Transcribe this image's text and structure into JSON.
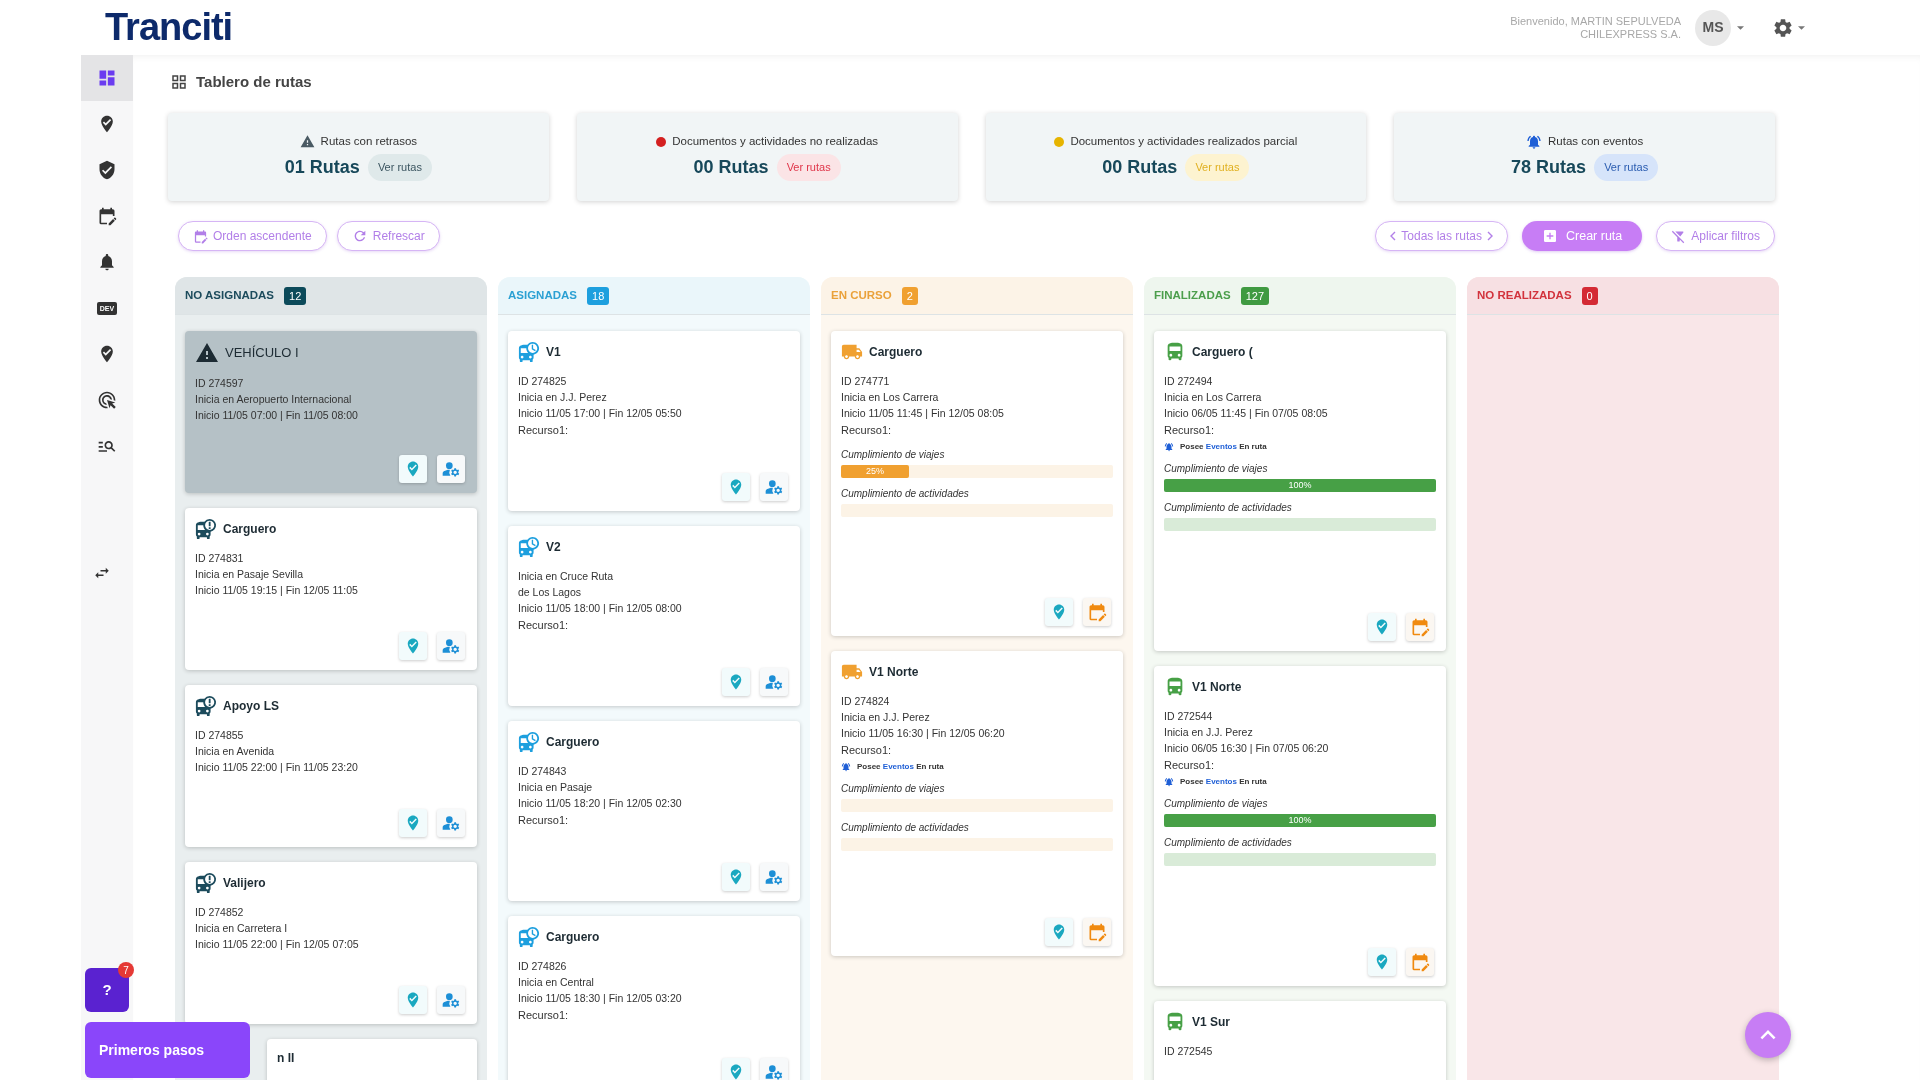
{
  "header": {
    "logo": "Tranciti",
    "welcome": "Bienvenido, MARTIN SEPULVEDA",
    "company": "CHILEXPRESS S.A.",
    "avatar": "MS"
  },
  "sidebar": {
    "items": [
      {
        "kind": "dashboard",
        "selected": true
      },
      {
        "kind": "pin-check",
        "selected": false
      },
      {
        "kind": "shield",
        "selected": false
      },
      {
        "kind": "calendar",
        "selected": false
      },
      {
        "kind": "bell",
        "selected": false
      },
      {
        "kind": "dev",
        "label": "DEV",
        "selected": false
      },
      {
        "kind": "pin-check",
        "selected": false
      },
      {
        "kind": "click",
        "selected": false
      },
      {
        "kind": "list-search",
        "selected": false
      }
    ]
  },
  "page_title": "Tablero de rutas",
  "summary_cards": [
    {
      "kind": "delay",
      "label": "Rutas con retrasos",
      "count": "01 Rutas",
      "button": "Ver rutas"
    },
    {
      "kind": "not_done",
      "label": "Documentos y actividades no realizadas",
      "count": "00 Rutas",
      "button": "Ver rutas"
    },
    {
      "kind": "partial",
      "label": "Documentos y actividades realizados parcial",
      "count": "00 Rutas",
      "button": "Ver rutas"
    },
    {
      "kind": "events",
      "label": "Rutas con eventos",
      "count": "78 Rutas",
      "button": "Ver rutas"
    }
  ],
  "toolbar": {
    "left": [
      {
        "kind": "sort",
        "label": "Orden ascendente"
      },
      {
        "kind": "refresh",
        "label": "Refrescar"
      }
    ],
    "right": [
      {
        "kind": "pager",
        "label": "Todas las rutas"
      },
      {
        "kind": "create",
        "label": "Crear ruta"
      },
      {
        "kind": "filter",
        "label": "Aplicar filtros"
      }
    ]
  },
  "columns": [
    {
      "kind": "unassigned",
      "title": "NO ASIGNADAS",
      "count": "12",
      "cards": [
        {
          "title": "VEHÍCULO I",
          "kind": "alert",
          "highlighted": true,
          "lines": [
            "ID 274597",
            "Inicia en Aeropuerto Internacional",
            "Inicio 11/05 07:00 | Fin 11/05 08:00"
          ]
        },
        {
          "title": "Carguero",
          "kind": "bus-alert",
          "highlighted": false,
          "lines": [
            "ID 274831",
            "Inicia en Pasaje Sevilla",
            "Inicio 11/05 19:15 | Fin 12/05 11:05"
          ]
        },
        {
          "title": "Apoyo LS",
          "kind": "bus-alert",
          "highlighted": false,
          "lines": [
            "ID 274855",
            "Inicia en Avenida",
            "Inicio 11/05 22:00 | Fin 11/05 23:20"
          ]
        },
        {
          "title": "Valijero",
          "kind": "bus-alert",
          "highlighted": false,
          "lines": [
            "ID 274852",
            "Inicia en Carretera I",
            "Inicio 11/05 22:00 | Fin 12/05 07:05"
          ]
        },
        {
          "title": "n II",
          "kind": "covered",
          "highlighted": false
        }
      ]
    },
    {
      "kind": "assigned",
      "title": "ASIGNADAS",
      "count": "18",
      "cards": [
        {
          "title": "V1",
          "kind": "bus-clock",
          "highlighted": false,
          "lines": [
            "ID 274825",
            "Inicia en J.J. Perez",
            "Inicio 11/05 17:00 | Fin 12/05 05:50"
          ],
          "resource": "Recurso1:"
        },
        {
          "title": "V2",
          "kind": "bus-clock",
          "highlighted": false,
          "lines": [
            "Inicia en Cruce Ruta",
            "de Los Lagos",
            "Inicio 11/05 18:00 | Fin 12/05 08:00"
          ],
          "resource": "Recurso1:"
        },
        {
          "title": "Carguero",
          "kind": "bus-clock",
          "highlighted": false,
          "lines": [
            "ID 274843",
            "Inicia en Pasaje",
            "Inicio 11/05 18:20 | Fin 12/05 02:30"
          ],
          "resource": "Recurso1:"
        },
        {
          "title": "Carguero",
          "kind": "bus-clock",
          "highlighted": false,
          "lines": [
            "ID 274826",
            "Inicia en Central",
            "Inicio 11/05 18:30 | Fin 12/05 03:20"
          ],
          "resource": "Recurso1:"
        }
      ]
    },
    {
      "kind": "in_progress",
      "title": "EN CURSO",
      "count": "2",
      "cards": [
        {
          "title": "Carguero",
          "kind": "truck",
          "highlighted": false,
          "lines": [
            "ID 274771",
            "Inicia en Los Carrera",
            "Inicio 11/05 11:45 | Fin 12/05 08:05"
          ],
          "resource": "Recurso1:",
          "progress": [
            {
              "label": "Cumplimiento de viajes",
              "level": 0.25,
              "reading": "25%"
            },
            {
              "label": "Cumplimiento de actividades",
              "level": 0
            }
          ]
        },
        {
          "title": "V1 Norte",
          "kind": "truck",
          "highlighted": false,
          "lines": [
            "ID 274824",
            "Inicia en J.J. Perez",
            "Inicio 11/05 16:30 | Fin 12/05 06:20"
          ],
          "resource": "Recurso1:",
          "events": {
            "before": "Posee",
            "link": "Eventos",
            "after": "En ruta"
          },
          "progress": [
            {
              "label": "Cumplimiento de viajes",
              "level": 0
            },
            {
              "label": "Cumplimiento de actividades",
              "level": 0
            }
          ]
        }
      ]
    },
    {
      "kind": "finished",
      "title": "FINALIZADAS",
      "count": "127",
      "cards": [
        {
          "title": "Carguero (",
          "kind": "bus-check",
          "highlighted": false,
          "lines": [
            "ID 272494",
            "Inicia en Los Carrera",
            "Inicio 06/05 11:45 | Fin 07/05 08:05"
          ],
          "resource": "Recurso1:",
          "events": {
            "before": "Posee",
            "link": "Eventos",
            "after": "En ruta"
          },
          "progress": [
            {
              "label": "Cumplimiento de viajes",
              "level": 1,
              "reading": "100%"
            },
            {
              "label": "Cumplimiento de actividades",
              "level": 0
            }
          ]
        },
        {
          "title": "V1 Norte",
          "kind": "bus-check",
          "highlighted": false,
          "lines": [
            "ID 272544",
            "Inicia en J.J. Perez",
            "Inicio 06/05 16:30 | Fin 07/05 06:20"
          ],
          "resource": "Recurso1:",
          "events": {
            "before": "Posee",
            "link": "Eventos",
            "after": "En ruta"
          },
          "progress": [
            {
              "label": "Cumplimiento de viajes",
              "level": 1,
              "reading": "100%"
            },
            {
              "label": "Cumplimiento de actividades",
              "level": 0
            }
          ]
        },
        {
          "title": "V1 Sur",
          "kind": "bus-check",
          "highlighted": false,
          "lines": [
            "ID 272545"
          ]
        }
      ]
    },
    {
      "kind": "not_done",
      "title": "NO REALIZADAS",
      "count": "0"
    }
  ],
  "help": {
    "label": "?",
    "badge": "7"
  },
  "onboarding_button": "Primeros pasos"
}
